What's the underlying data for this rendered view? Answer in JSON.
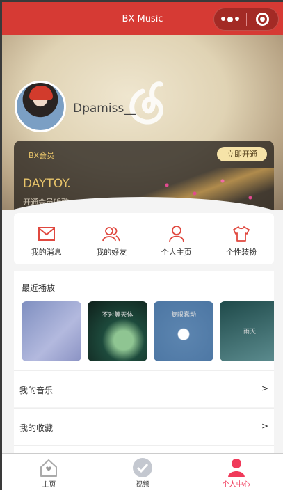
{
  "header": {
    "title": "BX Music",
    "more_icon": "more-dots-icon",
    "capsule_icon": "target-icon"
  },
  "profile": {
    "username": "Dpamiss__"
  },
  "vip": {
    "tag": "BX会员",
    "button": "立即开通",
    "title": "DAYTOY.",
    "subtitle": "开通会员听歌"
  },
  "quick": [
    {
      "label": "我的消息",
      "icon": "mail-icon"
    },
    {
      "label": "我的好友",
      "icon": "friends-icon"
    },
    {
      "label": "个人主页",
      "icon": "user-icon"
    },
    {
      "label": "个性装扮",
      "icon": "tshirt-icon"
    }
  ],
  "recent": {
    "title": "最近播放",
    "covers": [
      {
        "text": ""
      },
      {
        "text": "不对等天体"
      },
      {
        "text": "复眼蠢动"
      },
      {
        "text": "雨天"
      }
    ]
  },
  "list": [
    {
      "label": "我的音乐",
      "arrow": ">"
    },
    {
      "label": "我的收藏",
      "arrow": ">"
    }
  ],
  "tabs": [
    {
      "label": "主页",
      "icon": "home-icon"
    },
    {
      "label": "视频",
      "icon": "video-check-icon"
    },
    {
      "label": "个人中心",
      "icon": "person-icon"
    }
  ],
  "colors": {
    "primary": "#d63a34",
    "active_tab": "#f03a5a",
    "vip_gold": "#e8c46a"
  }
}
